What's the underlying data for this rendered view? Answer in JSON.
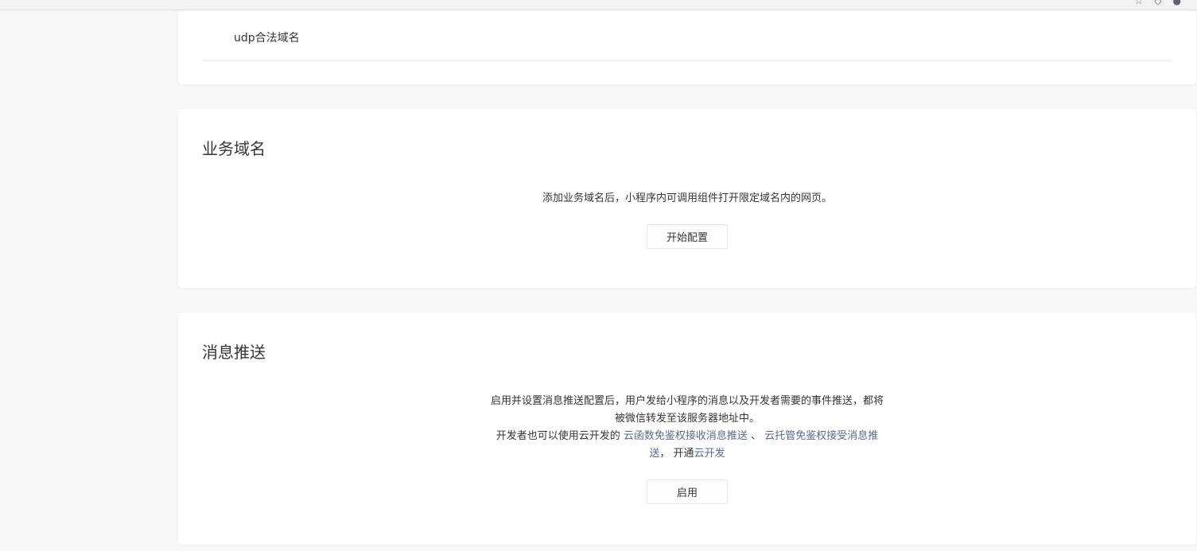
{
  "udp_section": {
    "label": "udp合法域名"
  },
  "business_domain": {
    "title": "业务域名",
    "description": "添加业务域名后，小程序内可调用组件打开限定域名内的网页。",
    "button_label": "开始配置"
  },
  "message_push": {
    "title": "消息推送",
    "line1": "启用并设置消息推送配置后，用户发给小程序的消息以及开发者需要的事件推送，都将被微信转发至该服务器地址中。",
    "line2_prefix": "开发者也可以使用云开发的 ",
    "link1": "云函数免鉴权接收消息推送",
    "sep": " 、 ",
    "link2": "云托管免鉴权接受消息推送",
    "line2_mid": "， 开通",
    "link3": "云开发",
    "button_label": "启用"
  },
  "colors": {
    "link": "#576b95",
    "background": "#f6f7f9",
    "card": "#ffffff"
  }
}
